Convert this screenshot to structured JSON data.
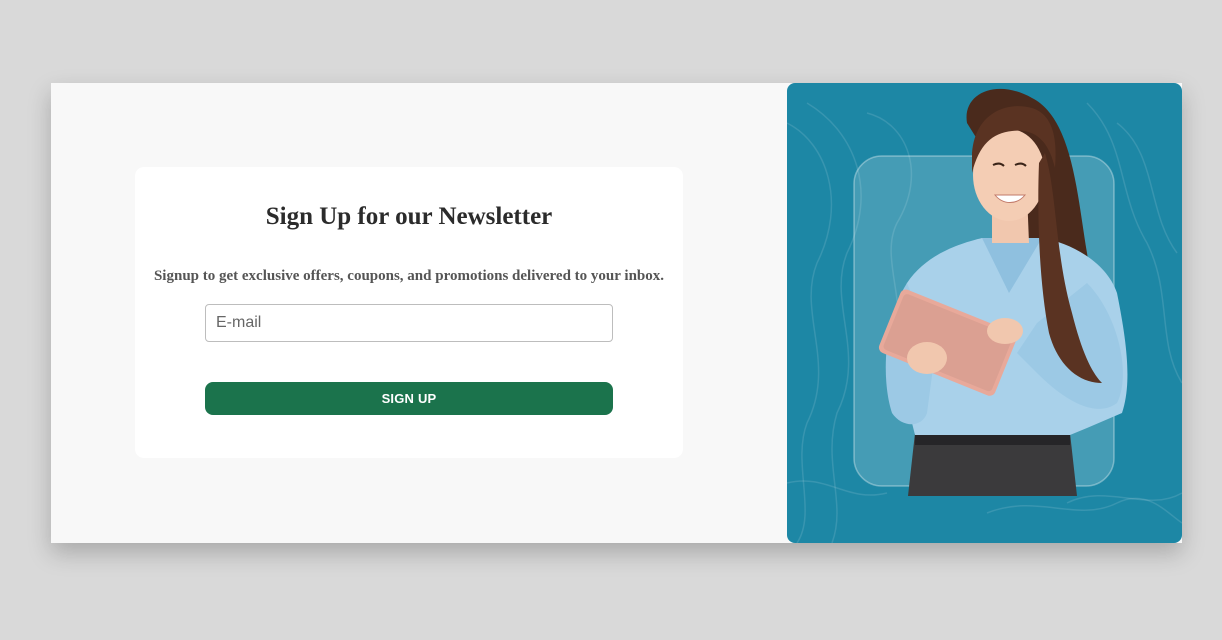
{
  "newsletter": {
    "title": "Sign Up for our Newsletter",
    "subtitle": "Signup to get exclusive offers, coupons, and promotions delivered to your inbox.",
    "email_placeholder": "E-mail",
    "email_value": "",
    "submit_label": "SIGN UP"
  },
  "colors": {
    "page_background": "#d9d9d9",
    "card_background": "#f8f8f8",
    "button": "#1b734c",
    "image_panel": "#1d87a5"
  },
  "image": {
    "icon": "woman-with-tablet-photo"
  }
}
